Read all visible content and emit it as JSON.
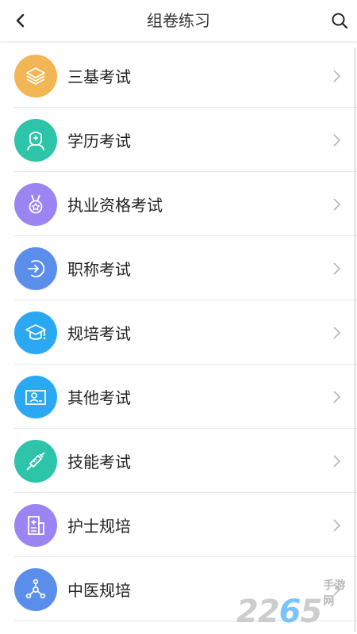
{
  "header": {
    "title": "组卷练习",
    "back_icon": "back-arrow-icon",
    "search_icon": "search-icon"
  },
  "items": [
    {
      "label": "三基考试",
      "icon": "layers-icon",
      "color": "#F2B654"
    },
    {
      "label": "学历考试",
      "icon": "student-icon",
      "color": "#2DC4AA"
    },
    {
      "label": "执业资格考试",
      "icon": "medal-icon",
      "color": "#9B85F2"
    },
    {
      "label": "职称考试",
      "icon": "login-icon",
      "color": "#5B8EEA"
    },
    {
      "label": "规培考试",
      "icon": "graduation-cap-icon",
      "color": "#2AA8F2"
    },
    {
      "label": "其他考试",
      "icon": "id-card-icon",
      "color": "#2AA8F2"
    },
    {
      "label": "技能考试",
      "icon": "syringe-icon",
      "color": "#2DC4AA"
    },
    {
      "label": "护士规培",
      "icon": "hospital-icon",
      "color": "#9B85F2"
    },
    {
      "label": "中医规培",
      "icon": "network-icon",
      "color": "#5B8EEA"
    }
  ],
  "watermark": {
    "number_main": "22",
    "number_accent": "6",
    "number_end": "5",
    "sub_text": "手游网"
  }
}
